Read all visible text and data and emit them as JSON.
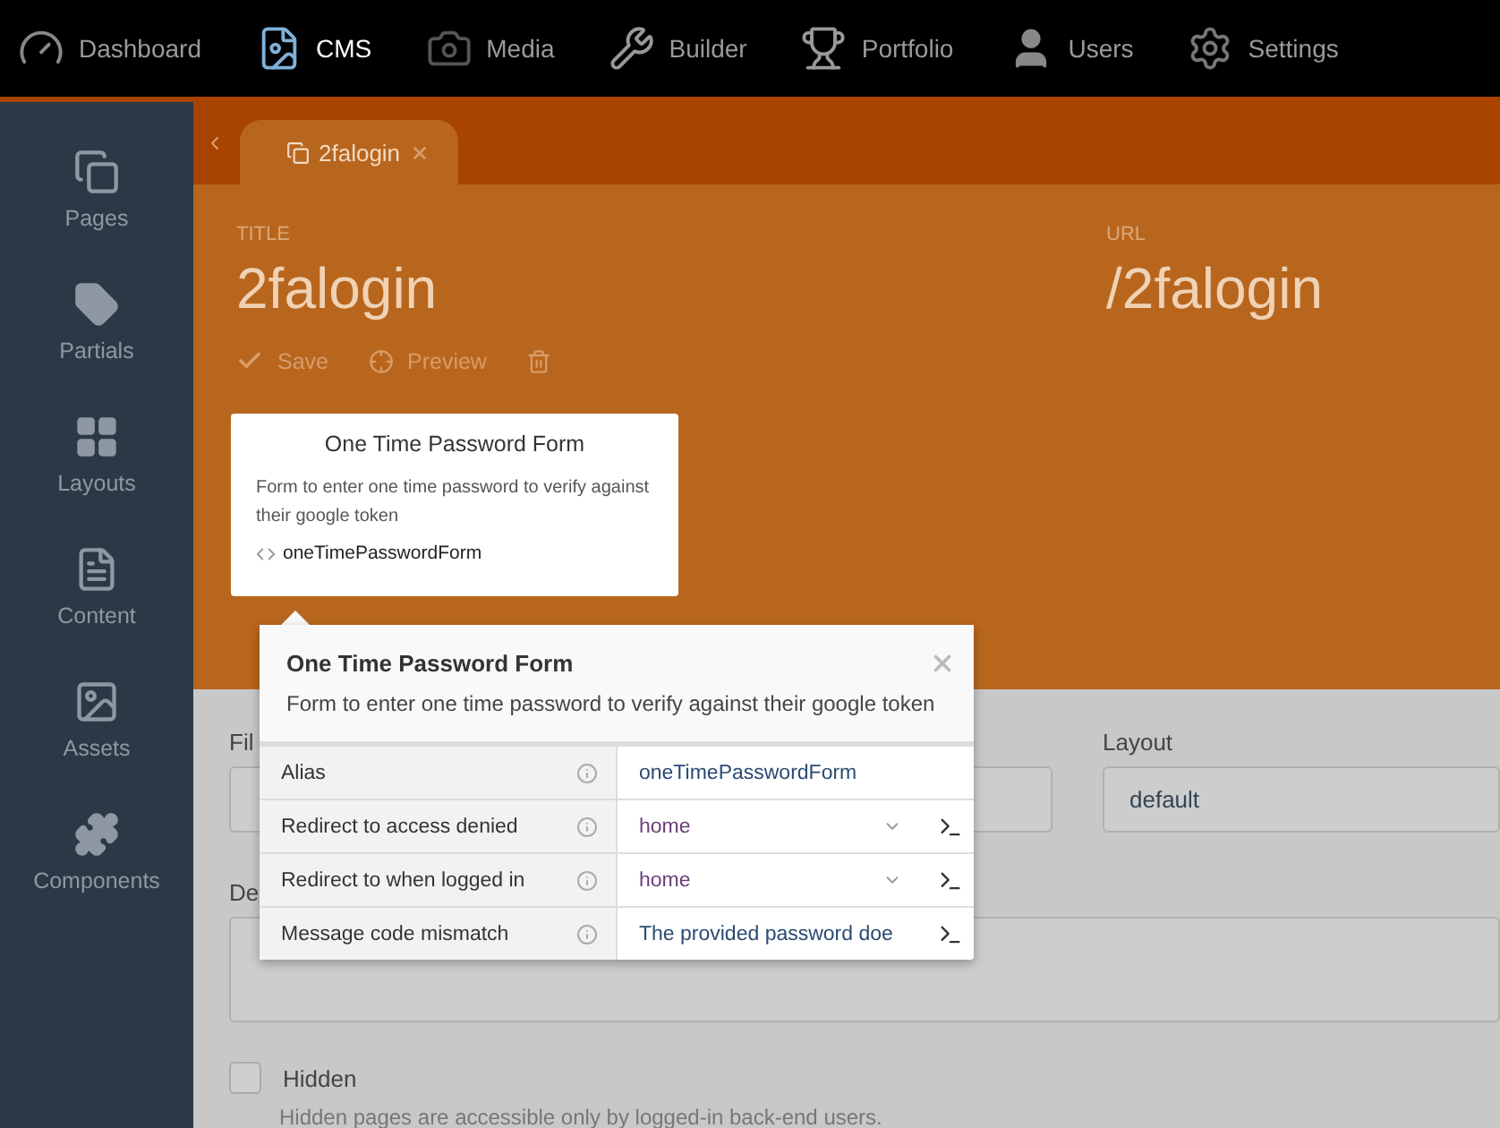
{
  "top_nav": [
    {
      "label": "Dashboard",
      "selected": false
    },
    {
      "label": "CMS",
      "selected": true
    },
    {
      "label": "Media",
      "selected": false
    },
    {
      "label": "Builder",
      "selected": false
    },
    {
      "label": "Portfolio",
      "selected": false
    },
    {
      "label": "Users",
      "selected": false
    },
    {
      "label": "Settings",
      "selected": false
    }
  ],
  "sidebar": {
    "items": [
      {
        "label": "Pages"
      },
      {
        "label": "Partials"
      },
      {
        "label": "Layouts"
      },
      {
        "label": "Content"
      },
      {
        "label": "Assets"
      },
      {
        "label": "Components"
      }
    ]
  },
  "tabs": [
    {
      "label": "2falogin",
      "selected": true
    }
  ],
  "header": {
    "title_label": "TITLE",
    "title": "2falogin",
    "url_label": "URL",
    "url": "/2falogin",
    "toolbar": [
      {
        "label": "Save",
        "kind": "save"
      },
      {
        "label": "Preview",
        "kind": "preview"
      },
      {
        "kind": "delete"
      }
    ]
  },
  "component_card": {
    "title": "One Time Password Form",
    "description": "Form to enter one time password to verify against their google token",
    "alias": "oneTimePasswordForm"
  },
  "inspector": {
    "title": "One Time Password Form",
    "description": "Form to enter one time password to verify against their google token",
    "rows": [
      {
        "label": "Alias",
        "kind": "text",
        "value": "oneTimePasswordForm"
      },
      {
        "label": "Redirect to access denied",
        "kind": "dropdown",
        "value": "home"
      },
      {
        "label": "Redirect to when logged in",
        "kind": "dropdown",
        "value": "home"
      },
      {
        "label": "Message code mismatch",
        "kind": "string",
        "value": "The provided password doe"
      }
    ]
  },
  "form": {
    "file_label": "Fil",
    "layout_label": "Layout",
    "layout_value": "default",
    "description_label": "De",
    "hidden": {
      "label": "Hidden",
      "checked": false,
      "hint": "Hidden pages are accessible only by logged-in back-end users."
    }
  }
}
